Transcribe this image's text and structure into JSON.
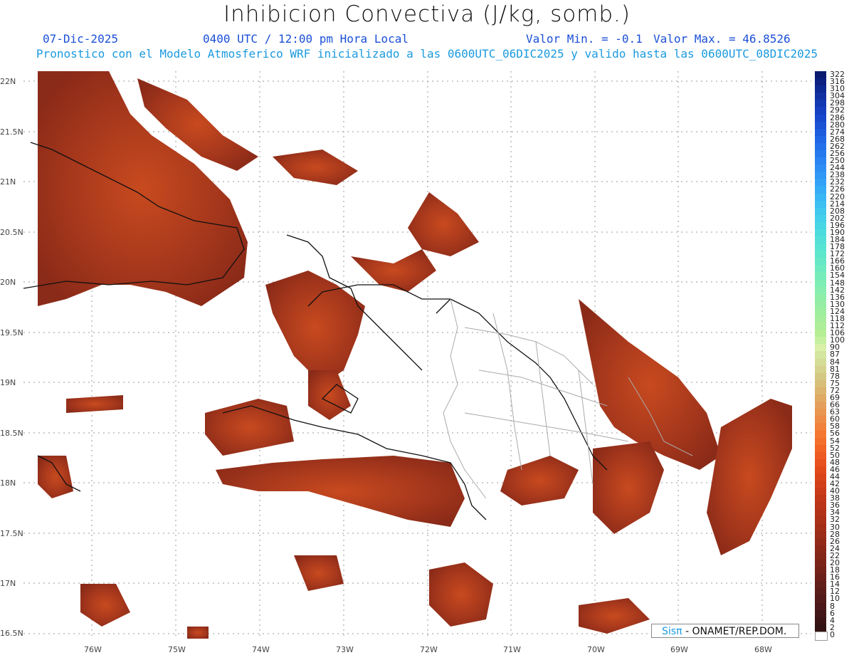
{
  "title": "Inhibicion Convectiva (J/kg, somb.)",
  "header": {
    "date": "07-Dic-2025",
    "time": "0400 UTC / 12:00 pm Hora Local",
    "min": "Valor Min. = -0.1",
    "max": "Valor Max. = 46.8526",
    "model_line": "Pronostico con el Modelo Atmosferico WRF inicializado a las 0600UTC_06DIC2025 y valido hasta las  0600UTC_08DIC2025"
  },
  "lat_labels": [
    "22N",
    "21.5N",
    "21N",
    "20.5N",
    "20N",
    "19.5N",
    "19N",
    "18.5N",
    "18N",
    "17.5N",
    "17N",
    "16.5N"
  ],
  "lon_labels": [
    "76W",
    "75W",
    "74W",
    "73W",
    "72W",
    "71W",
    "70W",
    "69W",
    "68W"
  ],
  "colorbar": {
    "labels": [
      "322",
      "316",
      "310",
      "304",
      "298",
      "292",
      "286",
      "280",
      "274",
      "268",
      "262",
      "256",
      "250",
      "244",
      "238",
      "232",
      "226",
      "220",
      "214",
      "208",
      "202",
      "196",
      "190",
      "184",
      "178",
      "172",
      "166",
      "160",
      "154",
      "148",
      "142",
      "136",
      "130",
      "124",
      "118",
      "112",
      "106",
      "100",
      "90",
      "87",
      "84",
      "81",
      "78",
      "75",
      "72",
      "69",
      "66",
      "63",
      "60",
      "58",
      "56",
      "54",
      "52",
      "50",
      "48",
      "46",
      "44",
      "42",
      "40",
      "38",
      "36",
      "34",
      "32",
      "30",
      "28",
      "26",
      "24",
      "22",
      "20",
      "18",
      "16",
      "14",
      "12",
      "10",
      "8",
      "6",
      "4",
      "2",
      "0"
    ],
    "colors": [
      "#0a1a6e",
      "#0b2080",
      "#0d2891",
      "#1030a2",
      "#1238b2",
      "#1540c0",
      "#1848cc",
      "#1b52d6",
      "#1e5cde",
      "#2166e4",
      "#2470ea",
      "#277aee",
      "#2a84f2",
      "#2d8ef4",
      "#3098f6",
      "#33a2f6",
      "#36acf6",
      "#39b6f4",
      "#3cc0f2",
      "#40c8ee",
      "#44d0ea",
      "#48d6e4",
      "#4cdcde",
      "#52e0d8",
      "#58e4d2",
      "#5ee6cc",
      "#66e8c6",
      "#6eeac0",
      "#76ecba",
      "#7eeeb4",
      "#86eeae",
      "#8eeea8",
      "#96eea4",
      "#9eeea0",
      "#a6ee9c",
      "#aeee98",
      "#b6ee94",
      "#c4f0a0",
      "#d8f0a8",
      "#d4e6a0",
      "#d4dc96",
      "#d4d28c",
      "#d4c882",
      "#d8be78",
      "#dcb46e",
      "#e0aa64",
      "#e4a05a",
      "#e89650",
      "#ec8c46",
      "#f0823c",
      "#f47832",
      "#f46e2c",
      "#f26426",
      "#ee5a22",
      "#e8521e",
      "#e24a1c",
      "#da441a",
      "#d23e18",
      "#ca3a18",
      "#c23618",
      "#ba3418",
      "#b23218",
      "#aa3018",
      "#a22e18",
      "#9a2c18",
      "#922a18",
      "#8a2818",
      "#822618",
      "#7a2418",
      "#722218",
      "#6a2018",
      "#621e18",
      "#5a1c18",
      "#521a18",
      "#4a1818",
      "#421616",
      "#3a1414",
      "#321212",
      "#ffffff"
    ]
  },
  "credit": {
    "sis": "Sisπ",
    "org": "- ONAMET/REP.DOM."
  }
}
